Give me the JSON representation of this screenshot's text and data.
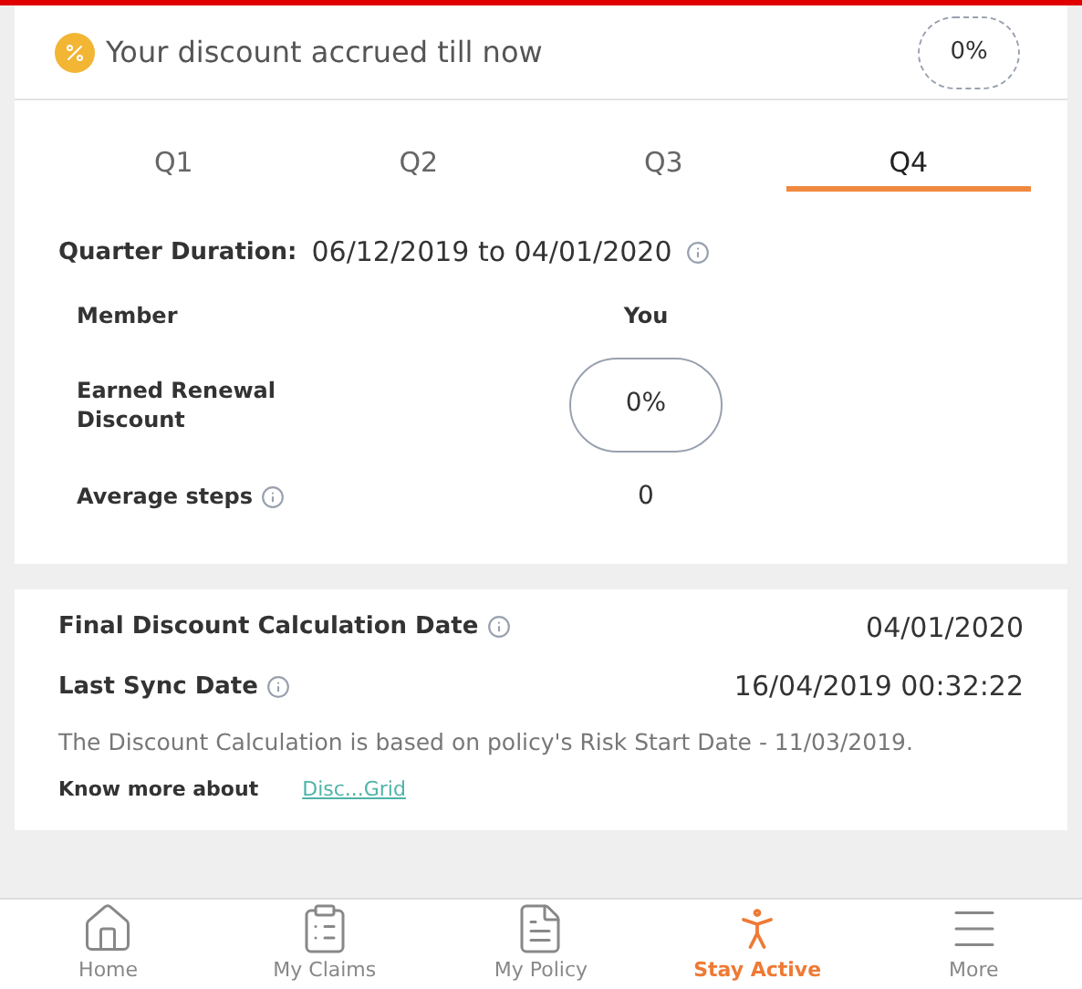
{
  "summary": {
    "label": "Your discount accrued till now",
    "value": "0%"
  },
  "tabs": [
    {
      "label": "Q1",
      "selected": false
    },
    {
      "label": "Q2",
      "selected": false
    },
    {
      "label": "Q3",
      "selected": false
    },
    {
      "label": "Q4",
      "selected": true
    }
  ],
  "quarter": {
    "label": "Quarter Duration:",
    "value": "06/12/2019 to 04/01/2020"
  },
  "member": {
    "label": "Member",
    "value": "You"
  },
  "earned": {
    "label": "Earned Renewal Discount",
    "value": "0%"
  },
  "steps": {
    "label": "Average steps",
    "value": "0"
  },
  "dates": [
    {
      "label": "Final Discount Calculation Date",
      "value": "04/01/2020"
    },
    {
      "label": "Last Sync Date",
      "value": "16/04/2019 00:32:22"
    }
  ],
  "note": "The Discount Calculation is based on policy's Risk Start Date - 11/03/2019.",
  "know_more": {
    "label": "Know more about",
    "link": "Disc...Grid"
  },
  "nav": [
    {
      "kind": "home",
      "label": "Home",
      "selected": false
    },
    {
      "kind": "claims",
      "label": "My Claims",
      "selected": false
    },
    {
      "kind": "policy",
      "label": "My Policy",
      "selected": false
    },
    {
      "kind": "active",
      "label": "Stay Active",
      "selected": true
    },
    {
      "kind": "more",
      "label": "More",
      "selected": false
    }
  ]
}
